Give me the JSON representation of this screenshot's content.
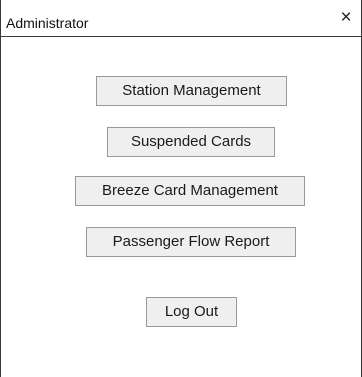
{
  "window": {
    "title": "Administrator",
    "close_symbol": "×"
  },
  "menu": {
    "station_management": "Station Management",
    "suspended_cards": "Suspended Cards",
    "breeze_card_management": "Breeze Card Management",
    "passenger_flow_report": "Passenger Flow Report",
    "log_out": "Log Out"
  }
}
